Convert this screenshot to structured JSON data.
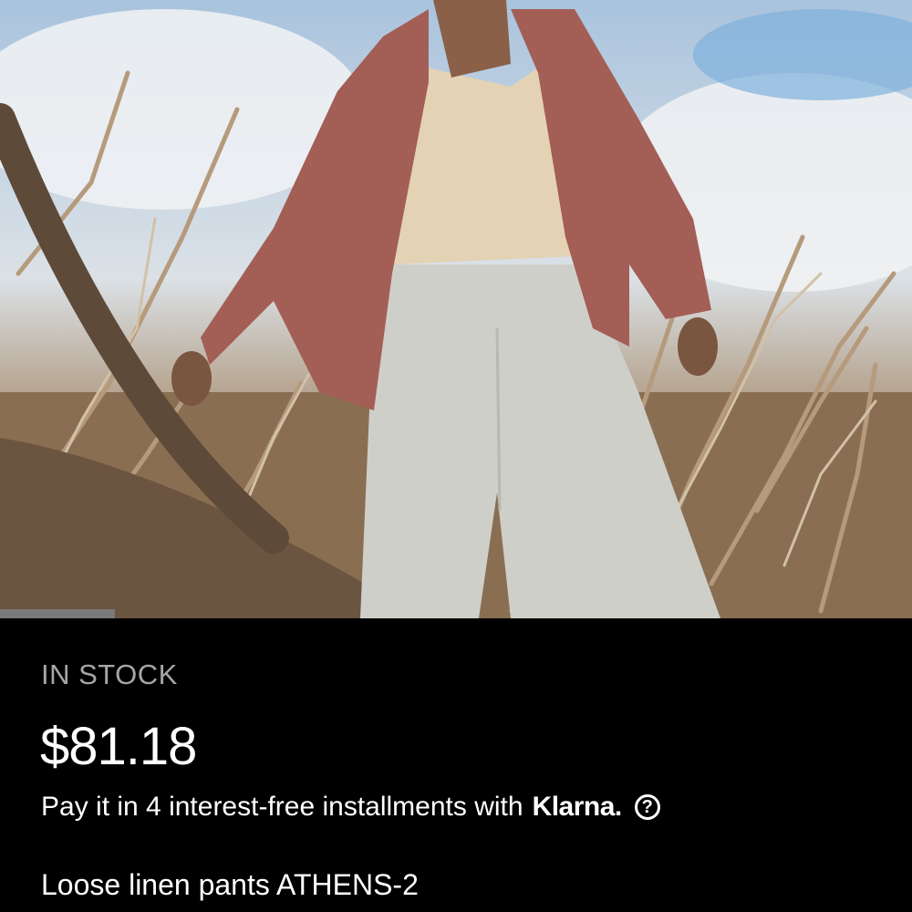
{
  "product": {
    "image_alt": "Model wearing loose linen pants with a pink linen shirt among dry branches",
    "stock_status": "IN STOCK",
    "price": "$81.18",
    "installments_text": "Pay it in 4 interest-free installments with",
    "installments_provider": "Klarna.",
    "help_icon": "question-circle-icon",
    "title": "Loose linen pants ATHENS-2"
  },
  "colors": {
    "background": "#000000",
    "stock_text": "#a6a6a6",
    "text": "#ffffff"
  }
}
